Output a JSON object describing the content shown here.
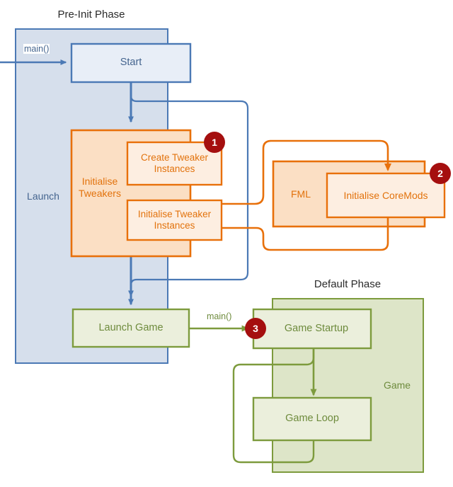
{
  "diagram": {
    "title_pre_init": "Pre-Init Phase",
    "title_default": "Default Phase",
    "colors": {
      "blue_stroke": "#4b79b5",
      "blue_container_fill": "#d6dfec",
      "blue_node_fill": "#e8eef7",
      "orange_stroke": "#e8700a",
      "orange_container_fill": "#fbdfc4",
      "orange_node_fill": "#fdeee1",
      "green_stroke": "#7d9b3d",
      "green_container_fill": "#dde5c8",
      "green_node_fill": "#ebefdc",
      "badge_fill": "#a50f0f",
      "title_color": "#2b2b2b"
    }
  },
  "groups": {
    "launch": {
      "label": "Launch"
    },
    "initialise_tweakers": {
      "label": "Initialise\nTweakers"
    },
    "fml": {
      "label": "FML"
    },
    "game": {
      "label": "Game"
    }
  },
  "nodes": {
    "start": {
      "label": "Start"
    },
    "create_tweaker_instances": {
      "label": "Create Tweaker\nInstances"
    },
    "initialise_tweaker_instances": {
      "label": "Initialise Tweaker\nInstances"
    },
    "initialise_coremods": {
      "label": "Initialise CoreMods"
    },
    "launch_game": {
      "label": "Launch Game"
    },
    "game_startup": {
      "label": "Game Startup"
    },
    "game_loop": {
      "label": "Game Loop"
    }
  },
  "edges": {
    "entry_main": {
      "label": "main()"
    },
    "launch_to_startup": {
      "label": "main()"
    }
  },
  "badges": {
    "one": {
      "label": "1"
    },
    "two": {
      "label": "2"
    },
    "three": {
      "label": "3"
    }
  }
}
